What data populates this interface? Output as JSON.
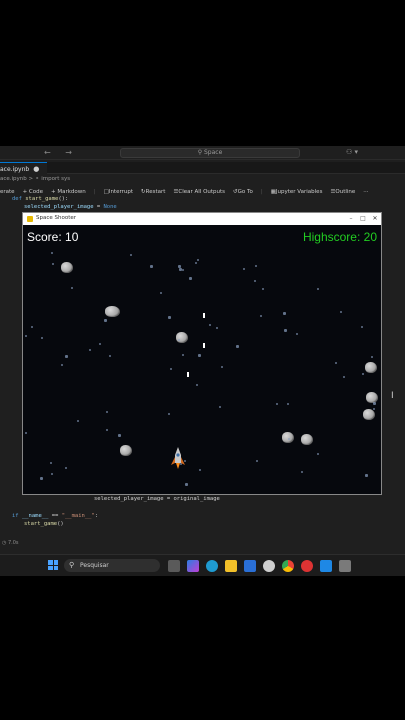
{
  "editor": {
    "search_text": "Space",
    "tab_label": "ace.ipynb",
    "breadcrumb": "ace.ipynb > ⚬ import sys",
    "toolbar": {
      "generate": "erate",
      "code": "+ Code",
      "markdown": "+ Markdown",
      "interrupt": "Interrupt",
      "restart": "Restart",
      "clear_outputs": "Clear All Outputs",
      "go_to": "Go To",
      "jupyter_variables": "Jupyter Variables",
      "outline": "Outline",
      "more": "···"
    },
    "code_lines": {
      "def_kw": "def",
      "def_name": "start_game",
      "def_rest": "():",
      "line2_var": "selected_player_image",
      "line2_op": " = ",
      "line2_val": "None",
      "line3": "selected_player_image = original_image",
      "line4_kw": "if",
      "line4_var": "__name__",
      "line4_op": " == ",
      "line4_str": "\"__main__\"",
      "line4_end": ":",
      "line5_fn": "start_game",
      "line5_end": "()"
    },
    "runtime_label": "7.0s"
  },
  "game": {
    "window_title": "Space Shooter",
    "score_text": "Score: 10",
    "highscore_text": "Highscore: 20"
  },
  "taskbar": {
    "search_placeholder": "Pesquisar"
  },
  "colors": {
    "highscore": "#22cc22",
    "score": "#ffffff",
    "canvas_bg": "#06080d"
  }
}
